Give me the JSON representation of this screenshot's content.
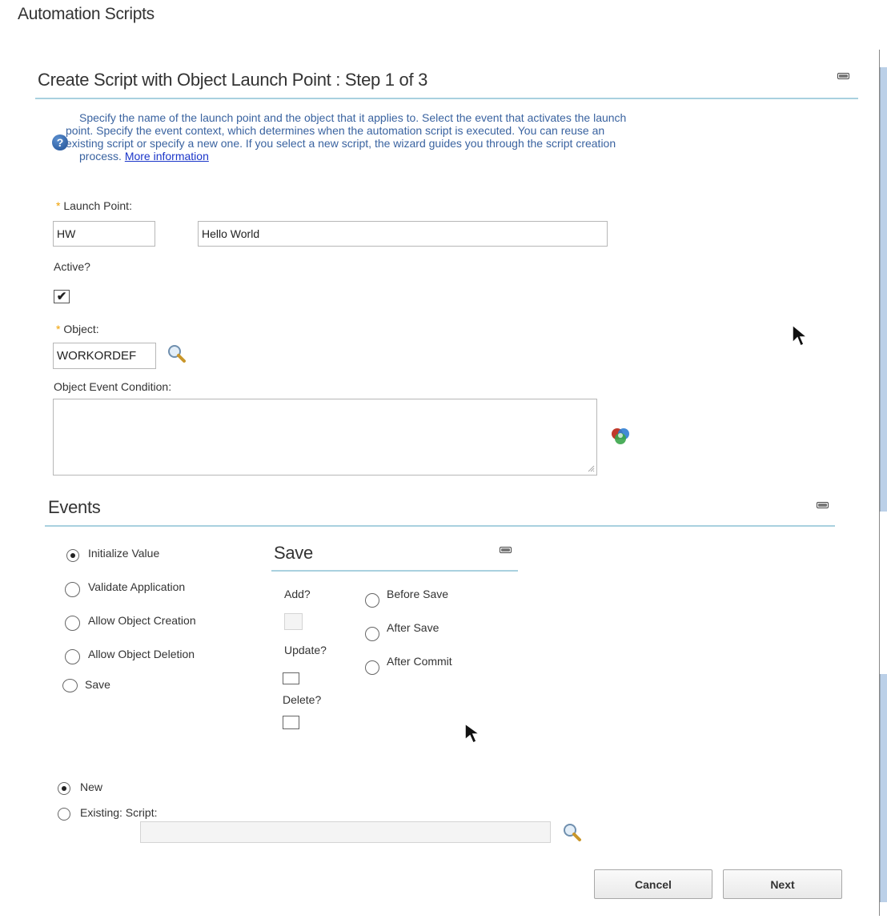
{
  "app": {
    "title": "Automation Scripts"
  },
  "wizard": {
    "title": "Create Script with Object Launch Point : Step 1 of 3",
    "help_line1": "Specify the name of the launch point and the object that it applies to. Select the event that activates the launch",
    "help_line2": "point. Specify the event context, which determines when the automation script is executed. You can reuse an",
    "help_line3": "existing script or specify a new one. If you select a new script, the wizard guides you through the script creation",
    "help_line4_prefix": "process. ",
    "help_link": "More information"
  },
  "fields": {
    "launch_point_label": "Launch Point:",
    "launch_point_value": "HW",
    "launch_point_desc": "Hello World",
    "active_label": "Active?",
    "active_checked": "✔",
    "object_label": "Object:",
    "object_value": "WORKORDEF",
    "condition_label": "Object Event Condition:",
    "condition_value": ""
  },
  "events": {
    "title": "Events",
    "options": [
      {
        "label": "Initialize Value",
        "checked": true
      },
      {
        "label": "Validate Application",
        "checked": false
      },
      {
        "label": "Allow Object Creation",
        "checked": false
      },
      {
        "label": "Allow Object Deletion",
        "checked": false
      },
      {
        "label": "Save",
        "checked": false
      }
    ]
  },
  "save": {
    "title": "Save",
    "add_label": "Add?",
    "update_label": "Update?",
    "delete_label": "Delete?",
    "timing": [
      "Before Save",
      "After Save",
      "After Commit"
    ]
  },
  "script": {
    "new_label": "New",
    "existing_label": "Existing: Script:",
    "existing_value": ""
  },
  "buttons": {
    "cancel": "Cancel",
    "next": "Next"
  },
  "colors": {
    "rule": "#a9d1df",
    "link": "#1a35c9",
    "help_text": "#3a63a0",
    "required": "#f0a000"
  }
}
